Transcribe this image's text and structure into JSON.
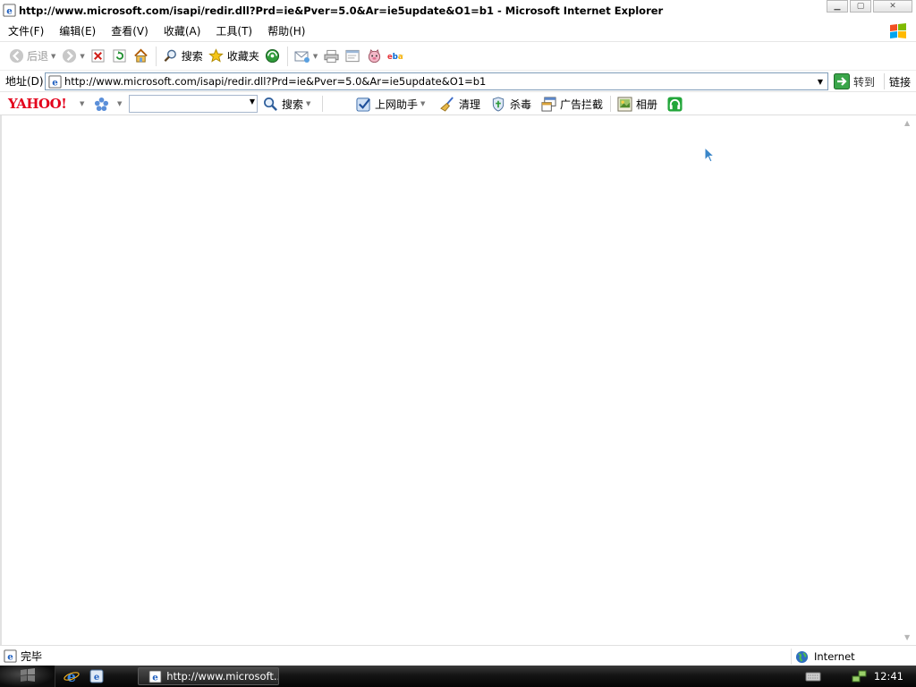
{
  "window": {
    "title": "http://www.microsoft.com/isapi/redir.dll?Prd=ie&Pver=5.0&Ar=ie5update&O1=b1 - Microsoft Internet Explorer",
    "controls": {
      "minimize": "minimize-icon",
      "maximize": "maximize-icon",
      "close": "close-icon"
    }
  },
  "menubar": {
    "items": [
      "文件(F)",
      "编辑(E)",
      "查看(V)",
      "收藏(A)",
      "工具(T)",
      "帮助(H)"
    ]
  },
  "toolbar": {
    "back_label": "后退",
    "search_label": "搜索",
    "favorites_label": "收藏夹",
    "icons": [
      "back-icon",
      "forward-icon",
      "stop-icon",
      "refresh-icon",
      "home-icon",
      "search-icon",
      "favorites-icon",
      "media-icon",
      "mail-icon",
      "print-icon",
      "edit-icon",
      "messenger-icon",
      "ebay-icon"
    ]
  },
  "addressbar": {
    "label": "地址(D)",
    "url": "http://www.microsoft.com/isapi/redir.dll?Prd=ie&Pver=5.0&Ar=ie5update&O1=b1",
    "go_label": "转到",
    "links_label": "链接"
  },
  "yahoo_toolbar": {
    "logo": "YAHOO!",
    "search_value": "",
    "search_label": "搜索",
    "helper_label": "上网助手",
    "clean_label": "清理",
    "antivirus_label": "杀毒",
    "adblock_label": "广告拦截",
    "album_label": "相册"
  },
  "statusbar": {
    "status_text": "完毕",
    "zone_label": "Internet"
  },
  "taskbar": {
    "task_label": "http://www.microsoft...",
    "clock": "12:41"
  },
  "colors": {
    "yahoo_red": "#e3001b",
    "ie_blue": "#1f5fbf",
    "taskbar_black": "#0a0a0a"
  }
}
